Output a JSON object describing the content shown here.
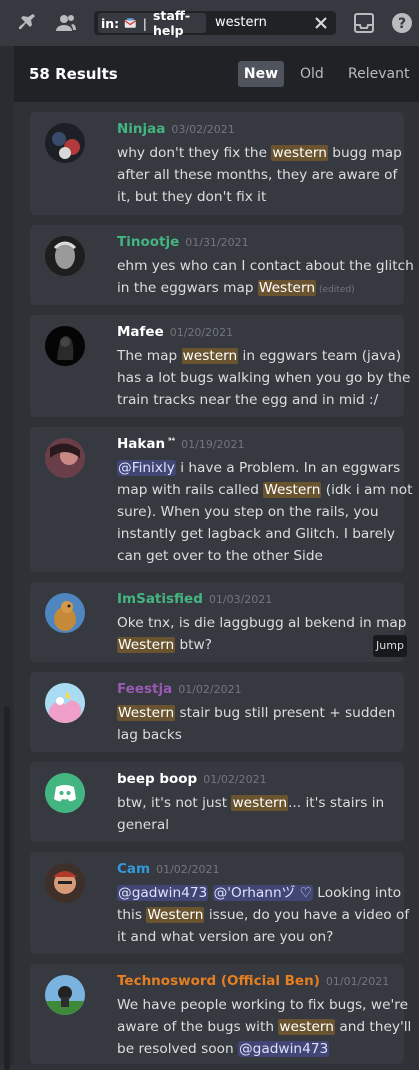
{
  "topbar": {
    "pin_icon": "pin-icon",
    "members_icon": "members-icon",
    "inbox_icon": "inbox-icon",
    "help_icon": "help-icon"
  },
  "search": {
    "filter_key": "in:",
    "channel": "staff-help",
    "query": "western"
  },
  "results": {
    "count_label": "58 Results",
    "sort_new": "New",
    "sort_old": "Old",
    "sort_relevant": "Relevant",
    "jump_label": "Jump"
  },
  "messages": [
    {
      "author": "Ninjaa",
      "author_color": "#43b581",
      "date": "03/02/2021",
      "parts": [
        "why don't they fix the ",
        "western",
        " bugg map after all these months, they are aware of it, but they don't fix it"
      ]
    },
    {
      "author": "Tinootje",
      "author_color": "#43b581",
      "date": "01/31/2021",
      "parts": [
        "ehm yes who can I contact about the glitch in the eggwars map ",
        "Western"
      ],
      "edited": "(edited)"
    },
    {
      "author": "Mafee",
      "author_color": "#ffffff",
      "date": "01/20/2021",
      "parts": [
        "The map ",
        "western",
        " in eggwars team (java) has a lot bugs walking   when you go by the train tracks near the egg and in mid :/"
      ]
    },
    {
      "author": "Hakan",
      "author_badge": "⁹⁴",
      "author_color": "#ffffff",
      "date": "01/19/2021",
      "mention": "@Finixly",
      "parts": [
        " i have a Problem. In an eggwars map with rails called ",
        "Western",
        " (idk i am not sure). When you step on the rails, you instantly get lagback and Glitch. I barely can get over to the other Side"
      ]
    },
    {
      "author": "ImSatisfied",
      "author_color": "#43b581",
      "date": "01/03/2021",
      "parts": [
        "Oke tnx, is die laggbugg al bekend in map ",
        "Western",
        " btw?"
      ]
    },
    {
      "author": "Feestja",
      "author_color": "#9b59b6",
      "date": "01/02/2021",
      "parts": [
        "",
        "Western",
        " stair bug still present + sudden lag backs"
      ]
    },
    {
      "author": "beep boop",
      "author_color": "#ffffff",
      "date": "01/02/2021",
      "parts": [
        "btw, it's not just ",
        "western",
        "... it's stairs in general"
      ]
    },
    {
      "author": "Cam",
      "author_color": "#3498db",
      "date": "01/02/2021",
      "mention": "@gadwin473",
      "mention2": "@'Orhannヅ ♡",
      "parts": [
        " Looking into this ",
        "Western",
        " issue, do you have a video of it and what version are you on?"
      ]
    },
    {
      "author": "Technosword (Official Ben)",
      "author_color": "#e67e22",
      "date": "01/01/2021",
      "parts": [
        "We have people working to fix bugs, we're aware of the bugs with ",
        "western",
        " and they'll be resolved soon "
      ],
      "mention_end": "@gadwin473"
    }
  ]
}
